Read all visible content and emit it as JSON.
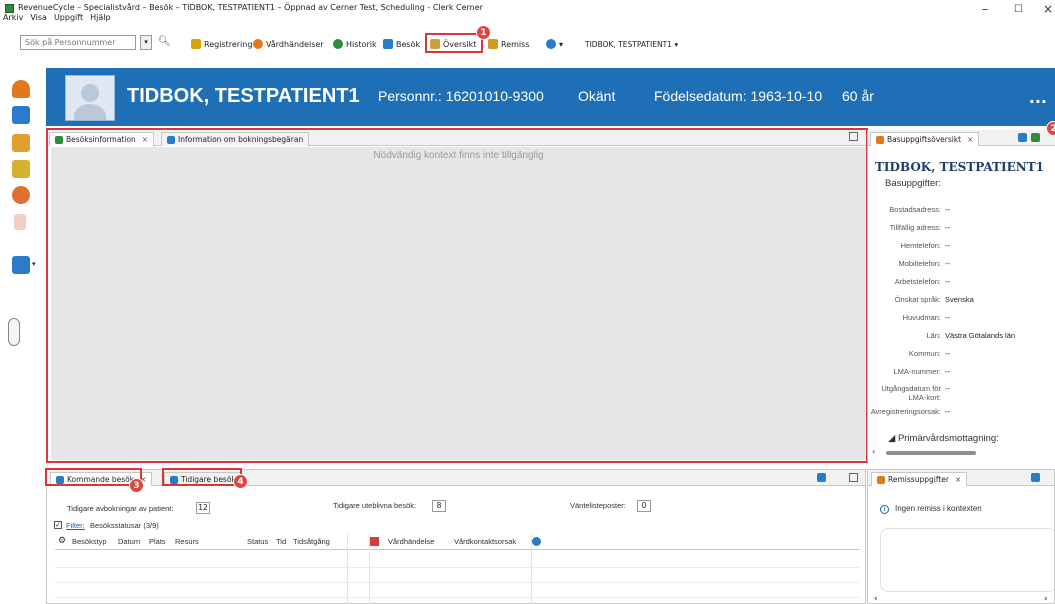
{
  "window": {
    "title": "RevenueCycle – Specialistvård – Besök – TIDBOK, TESTPATIENT1 – Öppnad av Cerner Test, Scheduling - Clerk Cerner",
    "minimize": "–",
    "maximize": "☐",
    "close": "×"
  },
  "menu": [
    "Arkiv",
    "Visa",
    "Uppgift",
    "Hjälp"
  ],
  "toolbar": {
    "search_placeholder": "Sök på Personnummer",
    "buttons": [
      {
        "label": "Registrering",
        "icon": "pencil-icon",
        "color": "#d9a400"
      },
      {
        "label": "Vårdhändelser",
        "icon": "clock-icon",
        "color": "#e0781c"
      },
      {
        "label": "Historik",
        "icon": "history-icon",
        "color": "#2c8c3c"
      },
      {
        "label": "Besök",
        "icon": "visit-icon",
        "color": "#2a7bc8"
      },
      {
        "label": "Översikt",
        "icon": "overview-icon",
        "color": "#c8a23c"
      },
      {
        "label": "Remiss",
        "icon": "referral-icon",
        "color": "#d09a20"
      }
    ],
    "patient_switch": "TIDBOK, TESTPATIENT1",
    "dropdown_arrow": "▾"
  },
  "badges": [
    "1",
    "2",
    "3",
    "4"
  ],
  "banner": {
    "name": "TIDBOK, TESTPATIENT1",
    "personnr": "Personnr.: 16201010-9300",
    "gender": "Okänt",
    "birthdate": "Födelsedatum: 1963-10-10",
    "age": "60 år",
    "more": "..."
  },
  "main_tabs": [
    {
      "label": "Besöksinformation",
      "close": "×"
    },
    {
      "label": "Information om bokningsbegäran"
    }
  ],
  "main_message": "Nödvändig kontext finns inte tillgänglig",
  "right_panel": {
    "tab": "Basuppgiftsöversikt",
    "close": "×",
    "patient_name": "TIDBOK, TESTPATIENT1",
    "subtitle": "Basuppgifter:",
    "rows": [
      {
        "label": "Bostadsadress:",
        "value": "--"
      },
      {
        "label": "Tillfällig adress:",
        "value": "--"
      },
      {
        "label": "Hemtelefon:",
        "value": "--"
      },
      {
        "label": "Mobiltelefon:",
        "value": "--"
      },
      {
        "label": "Arbetstelefon:",
        "value": "--"
      },
      {
        "label": "Önskat språk:",
        "value": "Svenska"
      },
      {
        "label": "Huvudman:",
        "value": "--"
      },
      {
        "label": "Län:",
        "value": "Västra Götalands län"
      },
      {
        "label": "Kommun:",
        "value": "--"
      },
      {
        "label": "LMA-nummer:",
        "value": "--"
      },
      {
        "label": "Utgångsdatum för",
        "label2": "LMA-kort:",
        "value": "--"
      },
      {
        "label": "Avregistreringsorsak:",
        "value": "--"
      }
    ],
    "section": "◢ Primärvårdsmottagning:"
  },
  "bottom_tabs": [
    {
      "label": "Kommande besök",
      "close": "×"
    },
    {
      "label": "Tidigare besök"
    }
  ],
  "bottom": {
    "cancellations_label": "Tidigare avbokningar av patient:",
    "cancellations_value": "12",
    "noshow_label": "Tidigare uteblivna besök:",
    "noshow_value": "8",
    "waitlist_label": "Väntelisteposter:",
    "waitlist_value": "0",
    "filter_link": "Filter:",
    "filter_text": "Besöksstatusar (3/9)",
    "columns": [
      "Besökstyp",
      "Datum",
      "Plats",
      "Resurs",
      "Status",
      "Tid",
      "Tidsåtgång",
      "Vårdhändelse",
      "Vårdkontaktsorsak"
    ]
  },
  "referral_panel": {
    "tab": "Remissuppgifter",
    "close": "×",
    "info": "Ingen remiss i kontexten"
  },
  "colors": {
    "banner": "#1e6fb6",
    "highlight": "#d6373e",
    "badge": "#e0463b"
  }
}
